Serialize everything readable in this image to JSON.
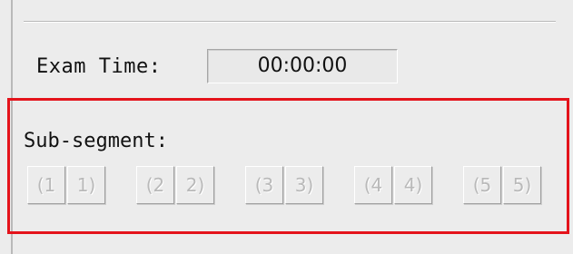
{
  "exam": {
    "label": "Exam Time:",
    "value": "00:00:00"
  },
  "subsegment": {
    "label": "Sub-segment:",
    "groups": [
      {
        "start": "(1",
        "end": "1)"
      },
      {
        "start": "(2",
        "end": "2)"
      },
      {
        "start": "(3",
        "end": "3)"
      },
      {
        "start": "(4",
        "end": "4)"
      },
      {
        "start": "(5",
        "end": "5)"
      }
    ]
  },
  "colors": {
    "highlight": "#e4131b",
    "disabled_text": "#b9b9b9"
  }
}
